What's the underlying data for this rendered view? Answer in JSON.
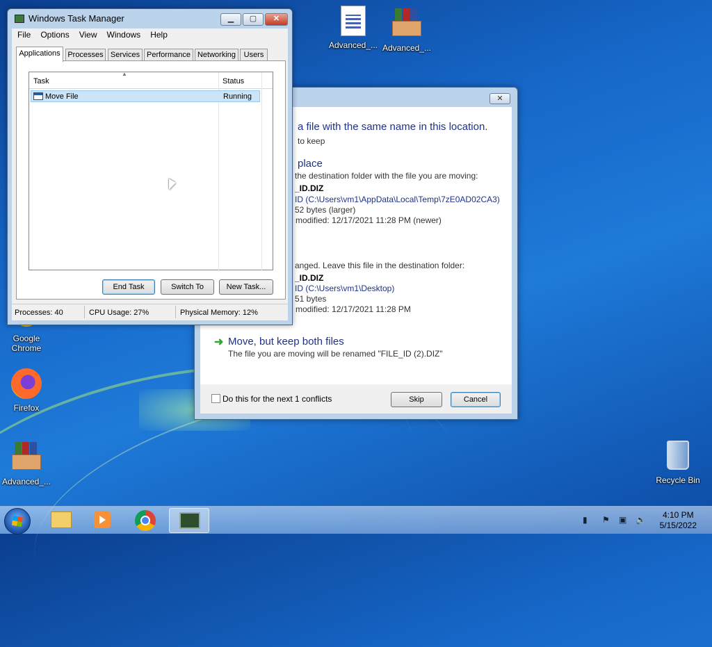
{
  "desktop": {
    "icons": [
      {
        "label": "Advanced_..."
      },
      {
        "label": "Advanced_..."
      },
      {
        "label": "Google Chrome"
      },
      {
        "label": "Firefox"
      },
      {
        "label": "Advanced_..."
      },
      {
        "label": "Recycle Bin"
      }
    ]
  },
  "task_manager": {
    "title": "Windows Task Manager",
    "menu": [
      "File",
      "Options",
      "View",
      "Windows",
      "Help"
    ],
    "tabs": [
      "Applications",
      "Processes",
      "Services",
      "Performance",
      "Networking",
      "Users"
    ],
    "columns": {
      "task": "Task",
      "status": "Status"
    },
    "rows": [
      {
        "task": "Move File",
        "status": "Running"
      }
    ],
    "buttons": {
      "end_task": "End Task",
      "switch_to": "Switch To",
      "new_task": "New Task..."
    },
    "status": {
      "processes": "Processes: 40",
      "cpu": "CPU Usage: 27%",
      "memory": "Physical Memory: 12%"
    }
  },
  "move_dialog": {
    "heading": "a file with the same name in this location.",
    "subheading": "to keep",
    "replace": {
      "title": "place",
      "desc": "the destination folder with the file you are moving:",
      "file": "_ID.DIZ",
      "path": "ID (C:\\Users\\vm1\\AppData\\Local\\Temp\\7zE0AD02CA3)",
      "size": "52 bytes (larger)",
      "modified": "modified: 12/17/2021 11:28 PM (newer)"
    },
    "dont_move": {
      "desc": "anged. Leave this file in the destination folder:",
      "file": "_ID.DIZ",
      "path": "ID (C:\\Users\\vm1\\Desktop)",
      "size": "51 bytes",
      "modified": "modified: 12/17/2021 11:28 PM"
    },
    "keep_both": {
      "title": "Move, but keep both files",
      "desc": "The file you are moving will be renamed \"FILE_ID (2).DIZ\""
    },
    "checkbox_label": "Do this for the next 1 conflicts",
    "buttons": {
      "skip": "Skip",
      "cancel": "Cancel"
    }
  },
  "taskbar": {
    "clock_time": "4:10 PM",
    "clock_date": "5/15/2022"
  }
}
